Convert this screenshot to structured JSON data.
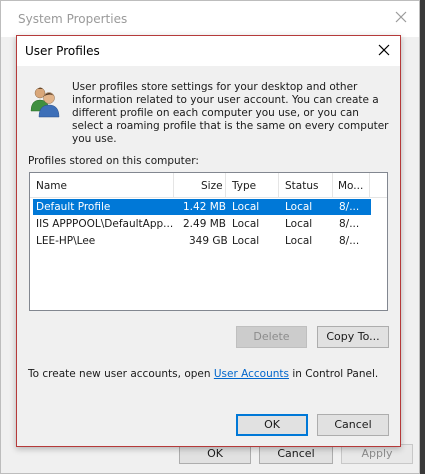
{
  "background_window": {
    "title": "System Properties",
    "ok_label": "OK",
    "cancel_label": "Cancel",
    "apply_label": "Apply"
  },
  "dialog": {
    "title": "User Profiles",
    "info_text": "User profiles store settings for your desktop and other information related to your user account. You can create a different profile on each computer you use, or you can select a roaming profile that is the same on every computer you use.",
    "stored_label": "Profiles stored on this computer:",
    "columns": [
      "Name",
      "Size",
      "Type",
      "Status",
      "Mo..."
    ],
    "rows": [
      {
        "name": "Default Profile",
        "size": "1.42 MB",
        "type": "Local",
        "status": "Local",
        "modified": "8/...",
        "selected": true
      },
      {
        "name": "IIS APPPOOL\\DefaultApp...",
        "size": "2.49 MB",
        "type": "Local",
        "status": "Local",
        "modified": "8/...",
        "selected": false
      },
      {
        "name": "LEE-HP\\Lee",
        "size": "349 GB",
        "type": "Local",
        "status": "Local",
        "modified": "8/...",
        "selected": false
      }
    ],
    "delete_label": "Delete",
    "copy_to_label": "Copy To...",
    "create_prefix": "To create new user accounts, open ",
    "create_link": "User Accounts",
    "create_suffix": " in Control Panel.",
    "ok_label": "OK",
    "cancel_label": "Cancel"
  },
  "colors": {
    "selection": "#0078d7",
    "dialog_border": "#b53a3a",
    "link": "#0066cc"
  }
}
